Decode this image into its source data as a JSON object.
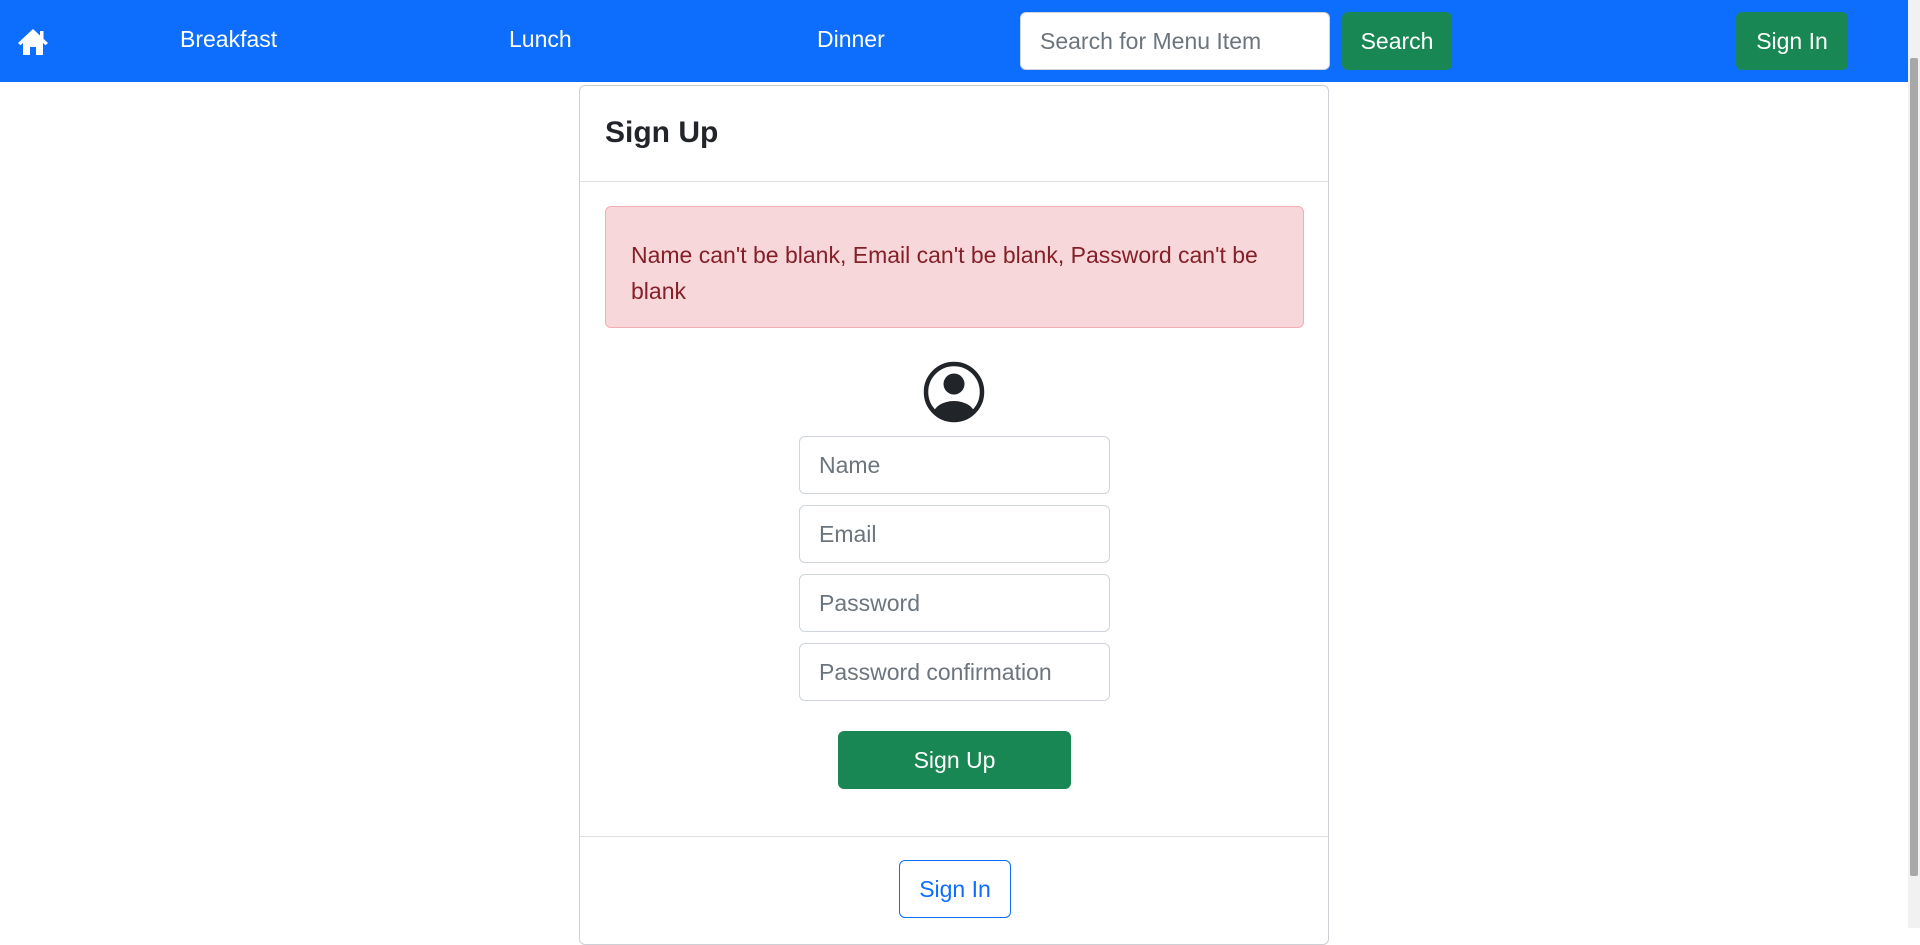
{
  "colors": {
    "navbar": "#0d6efd",
    "success": "#198754",
    "alert_bg": "#f8d7da",
    "alert_text": "#842029",
    "outline_primary": "#0d6efd"
  },
  "navbar": {
    "home_icon": "house-icon",
    "links": [
      {
        "label": "Breakfast"
      },
      {
        "label": "Lunch"
      },
      {
        "label": "Dinner"
      }
    ],
    "search": {
      "placeholder": "Search for Menu Item",
      "value": "",
      "button_label": "Search"
    },
    "signin_label": "Sign In"
  },
  "card": {
    "title": "Sign Up",
    "alert": "Name can't be blank, Email can't be blank, Password can't be blank",
    "avatar_icon": "person-circle-icon",
    "fields": {
      "name": {
        "placeholder": "Name",
        "value": ""
      },
      "email": {
        "placeholder": "Email",
        "value": ""
      },
      "password": {
        "placeholder": "Password",
        "value": ""
      },
      "password_confirmation": {
        "placeholder": "Password confirmation",
        "value": ""
      }
    },
    "submit_label": "Sign Up",
    "footer_signin_label": "Sign In"
  }
}
